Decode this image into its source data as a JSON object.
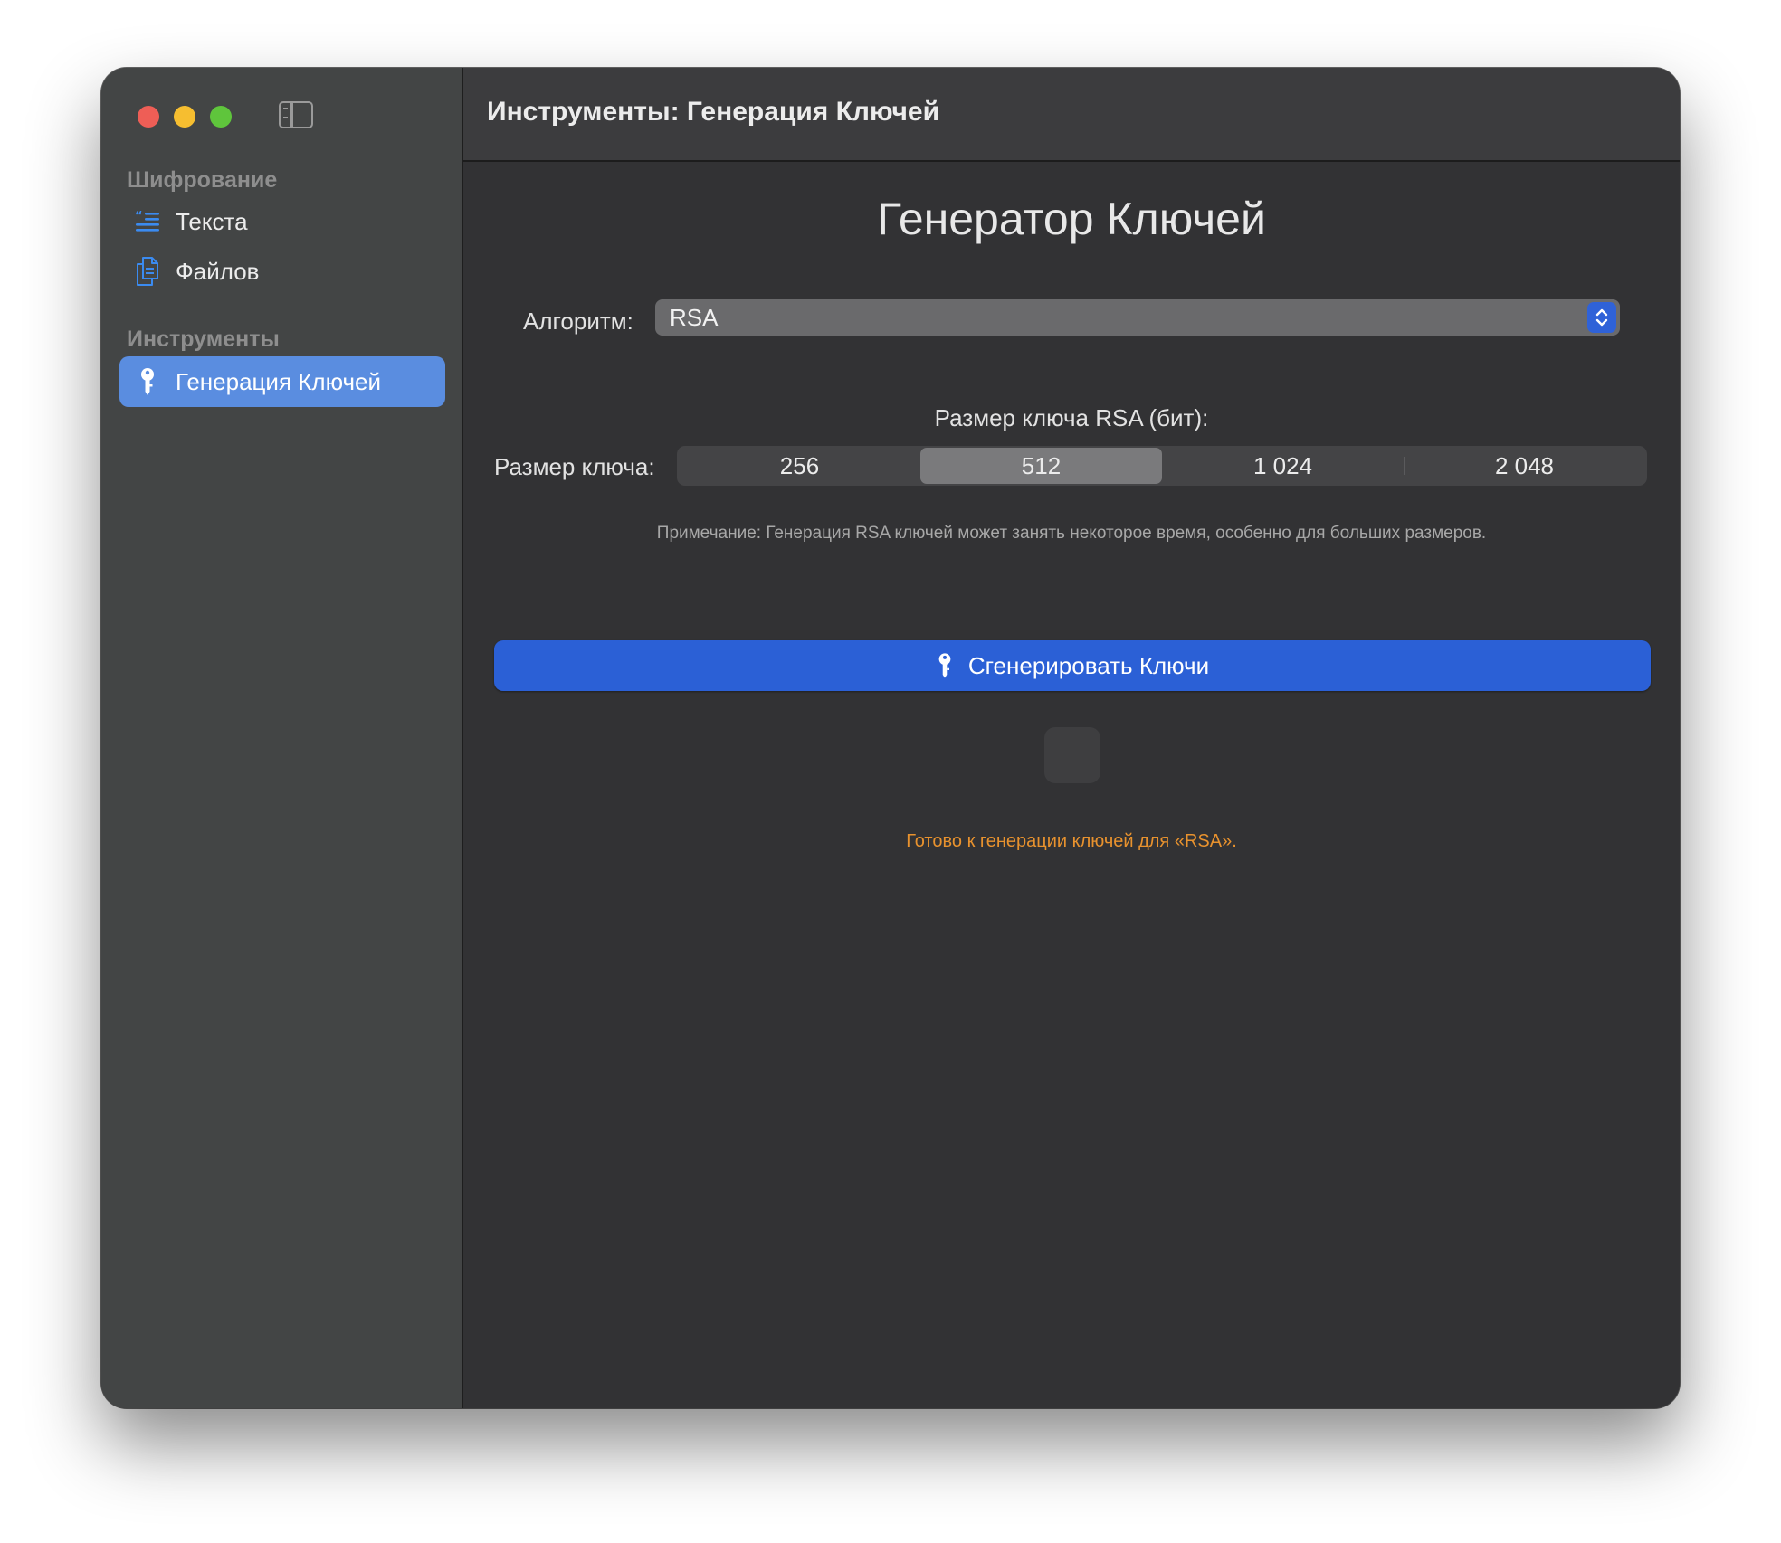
{
  "window": {
    "title": "Инструменты: Генерация Ключей"
  },
  "sidebar": {
    "sections": [
      {
        "header": "Шифрование",
        "items": [
          {
            "label": "Текста",
            "icon": "text-quote-icon",
            "selected": false
          },
          {
            "label": "Файлов",
            "icon": "documents-icon",
            "selected": false
          }
        ]
      },
      {
        "header": "Инструменты",
        "items": [
          {
            "label": "Генерация Ключей",
            "icon": "key-icon",
            "selected": true
          }
        ]
      }
    ]
  },
  "main": {
    "heading": "Генератор Ключей",
    "algorithm": {
      "label": "Алгоритм:",
      "value": "RSA"
    },
    "key_size": {
      "heading": "Размер ключа RSA (бит):",
      "label": "Размер ключа:",
      "options": [
        "256",
        "512",
        "1 024",
        "2 048"
      ],
      "selected": "512"
    },
    "note": "Примечание: Генерация RSA ключей может занять некоторое время, особенно для больших размеров.",
    "generate_button": "Сгенерировать Ключи",
    "status": "Готово к генерации ключей для «RSA»."
  },
  "colors": {
    "accent": "#2b60d6",
    "sidebar_selection": "#5a8de0",
    "status": "#e8922e"
  }
}
